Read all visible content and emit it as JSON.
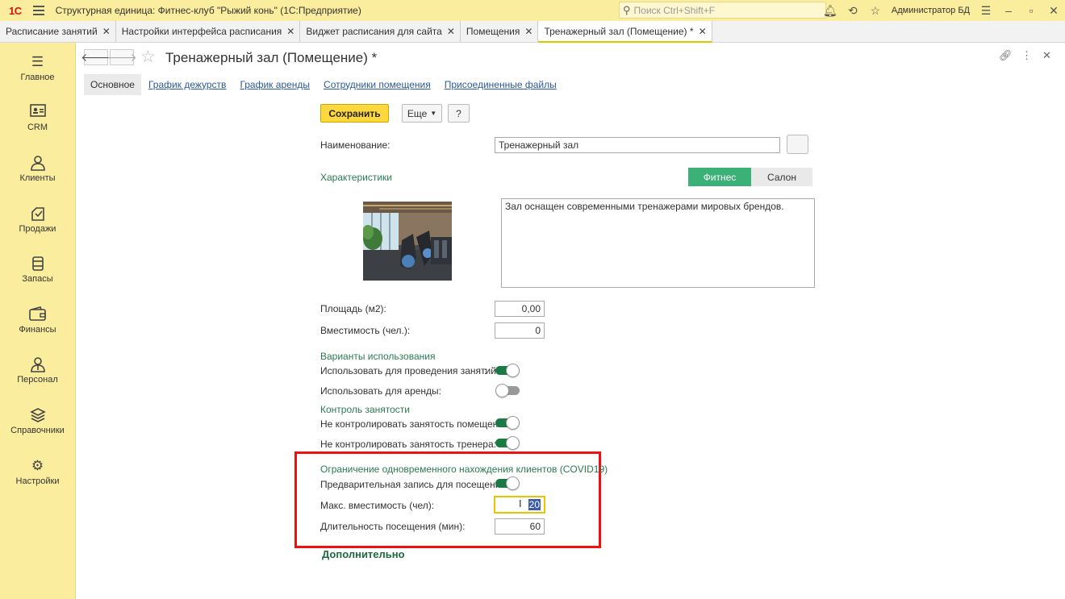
{
  "app": {
    "logo": "1С",
    "title": "Структурная единица: Фитнес-клуб \"Рыжий конь\" (1С:Предприятие)",
    "search_placeholder": "Поиск Ctrl+Shift+F",
    "user": "Администратор БД"
  },
  "tabs": [
    {
      "label": "Расписание занятий",
      "active": false
    },
    {
      "label": "Настройки интерфейса расписания",
      "active": false
    },
    {
      "label": "Виджет расписания для сайта",
      "active": false
    },
    {
      "label": "Помещения",
      "active": false
    },
    {
      "label": "Тренажерный зал (Помещение) *",
      "active": true
    }
  ],
  "sidebar": {
    "items": [
      {
        "label": "Главное",
        "icon": "menu-icon"
      },
      {
        "label": "CRM",
        "icon": "id-card-icon"
      },
      {
        "label": "Клиенты",
        "icon": "clients-icon"
      },
      {
        "label": "Продажи",
        "icon": "sales-icon"
      },
      {
        "label": "Запасы",
        "icon": "stock-icon"
      },
      {
        "label": "Финансы",
        "icon": "wallet-icon"
      },
      {
        "label": "Персонал",
        "icon": "staff-icon"
      },
      {
        "label": "Справочники",
        "icon": "layers-icon"
      },
      {
        "label": "Настройки",
        "icon": "gear-icon"
      }
    ]
  },
  "form": {
    "title": "Тренажерный зал (Помещение) *",
    "subtabs": [
      "Основное",
      "График дежурств",
      "График аренды",
      "Сотрудники помещения",
      "Присоединенные файлы"
    ],
    "save_label": "Сохранить",
    "more_label": "Еще",
    "help_label": "?",
    "name_label": "Наименование:",
    "name_value": "Тренажерный зал",
    "characteristics_label": "Характеристики",
    "segments": [
      "Фитнес",
      "Салон"
    ],
    "selected_segment": "Фитнес",
    "description": "Зал оснащен современными тренажерами мировых брендов.",
    "area_label": "Площадь (м2):",
    "area_value": "0,00",
    "capacity_label": "Вместимость (чел.):",
    "capacity_value": "0",
    "usage_section": "Варианты использования",
    "use_classes_label": "Использовать для проведения занятий",
    "use_classes_sep": ":",
    "use_classes_on": true,
    "use_rent_label": "Использовать для аренды:",
    "use_rent_on": false,
    "control_section": "Контроль занятости",
    "no_control_room_label": "Не контролировать занятость помещения:",
    "no_control_room_on": true,
    "no_control_trainer_label": "Не контролировать занятость тренера:",
    "no_control_trainer_on": true,
    "covid_section": "Ограничение одновременного нахождения клиентов (COVID19)",
    "prebook_label": "Предварительная запись для посещения:",
    "prebook_on": true,
    "max_capacity_label": "Макс. вместимость (чел):",
    "max_capacity_value": "20",
    "duration_label": "Длительность посещения (мин):",
    "duration_value": "60",
    "more_section": "Дополнительно"
  },
  "colors": {
    "accent_yellow": "#fbed9e",
    "save_button": "#fdd83c",
    "section_green": "#2c7a50",
    "toggle_on": "#1a7a43",
    "segment_active": "#3bb077",
    "highlight_red": "#e11111"
  }
}
